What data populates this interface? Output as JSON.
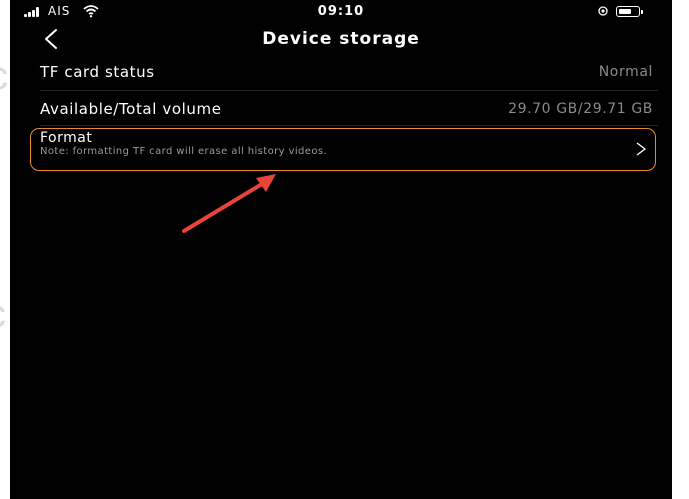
{
  "status_bar": {
    "carrier": "AIS",
    "time": "09:10"
  },
  "nav": {
    "title": "Device storage"
  },
  "rows": [
    {
      "label": "TF card status",
      "value": "Normal"
    },
    {
      "label": "Available/Total volume",
      "value": "29.70 GB/29.71 GB"
    }
  ],
  "format": {
    "label": "Format",
    "note": "Note:  formatting TF card will erase all history videos."
  },
  "colors": {
    "highlight": "#e88a2a",
    "arrow": "#e8443a",
    "background": "#000000"
  }
}
